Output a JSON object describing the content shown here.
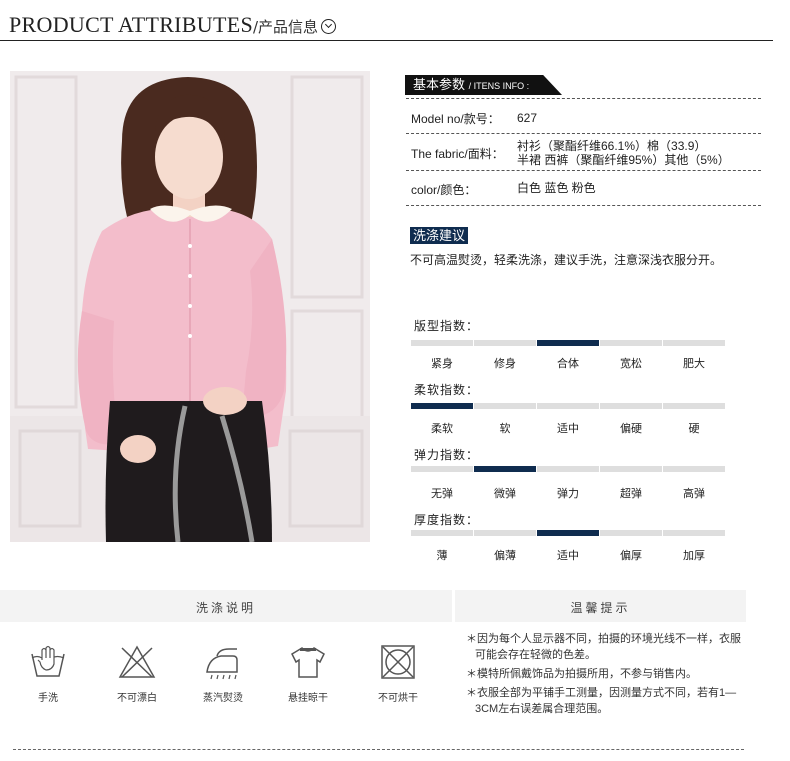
{
  "header": {
    "title": "PRODUCT ATTRIBUTES",
    "subtitle": "/产品信息"
  },
  "params": {
    "label_cn": "基本参数",
    "label_en": "/ ITENS INFO :",
    "rows": [
      {
        "key": "Model no/款号：",
        "value": "627"
      },
      {
        "key": "The fabric/面料：",
        "value": "衬衫（聚酯纤维66.1%）棉（33.9）",
        "value2": "半裙 西裤（聚酯纤维95%）其他（5%）"
      },
      {
        "key": "color/颜色：",
        "value": "白色  蓝色  粉色"
      }
    ]
  },
  "wash": {
    "label": "洗涤建议",
    "text": "不可高温熨烫，轻柔洗涤，建议手洗，注意深浅衣服分开。"
  },
  "indexes": [
    {
      "title": "版型指数：",
      "options": [
        "紧身",
        "修身",
        "合体",
        "宽松",
        "肥大"
      ],
      "selected": 2
    },
    {
      "title": "柔软指数：",
      "options": [
        "柔软",
        "软",
        "适中",
        "偏硬",
        "硬"
      ],
      "selected": 0
    },
    {
      "title": "弹力指数：",
      "options": [
        "无弹",
        "微弹",
        "弹力",
        "超弹",
        "高弹"
      ],
      "selected": 1
    },
    {
      "title": "厚度指数：",
      "options": [
        "薄",
        "偏薄",
        "适中",
        "偏厚",
        "加厚"
      ],
      "selected": 2
    }
  ],
  "care": {
    "heading": "洗涤说明",
    "items": [
      {
        "icon": "hand-wash-icon",
        "label": "手洗"
      },
      {
        "icon": "no-bleach-icon",
        "label": "不可漂白"
      },
      {
        "icon": "steam-iron-icon",
        "label": "蒸汽熨烫"
      },
      {
        "icon": "hang-dry-icon",
        "label": "悬挂晾干"
      },
      {
        "icon": "no-tumble-dry-icon",
        "label": "不可烘干"
      }
    ]
  },
  "tips": {
    "heading": "温馨提示",
    "items": [
      "＊因为每个人显示器不同，拍摄的环境光线不一样，衣服可能会存在轻微的色差。",
      "＊模特所佩戴饰品为拍摄所用，不参与销售内。",
      "＊衣服全部为平铺手工测量，因测量方式不同，若有1—3CM左右误差属合理范围。"
    ]
  },
  "colors": {
    "accent": "#0f2c4f",
    "bar_inactive": "#dedede",
    "panel_bg": "#f3f3f3"
  }
}
